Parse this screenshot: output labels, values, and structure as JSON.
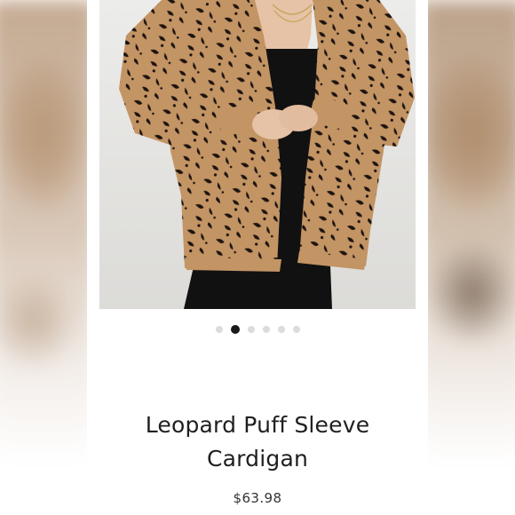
{
  "product": {
    "title_line1": "Leopard Puff Sleeve",
    "title_line2": "Cardigan",
    "price": "$63.98",
    "image_alt": "Leopard print fuzzy cardigan worn over black dress"
  },
  "carousel": {
    "total_slides": 6,
    "active_index": 1
  },
  "colors": {
    "cardigan_tan": "#c39464",
    "spot_black": "#1d1410",
    "dress_black": "#111111",
    "dot_active": "#1a1a1a",
    "dot_inactive": "#dcdcdc"
  }
}
